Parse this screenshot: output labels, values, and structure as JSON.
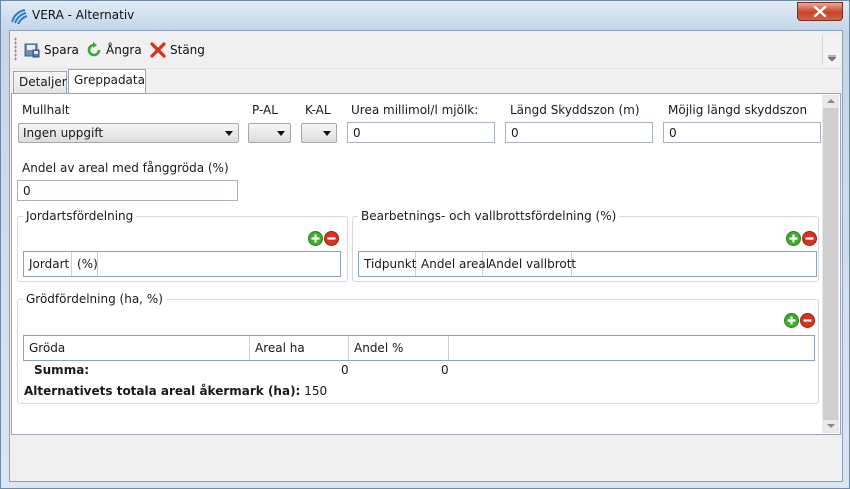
{
  "window": {
    "title": "VERA - Alternativ"
  },
  "toolbar": {
    "save_label": "Spara",
    "undo_label": "Ångra",
    "close_label": "Stäng"
  },
  "tabs": [
    {
      "label": "Detaljer"
    },
    {
      "label": "Greppadata"
    }
  ],
  "form": {
    "mullhalt": {
      "label": "Mullhalt",
      "value": "Ingen uppgift"
    },
    "pal": {
      "label": "P-AL",
      "value": ""
    },
    "kal": {
      "label": "K-AL",
      "value": ""
    },
    "urea": {
      "label": "Urea millimol/l mjölk:",
      "value": "0"
    },
    "skyddszon": {
      "label": "Längd Skyddszon (m)",
      "value": "0"
    },
    "mojlig": {
      "label": "Möjlig längd skyddszon",
      "value": "0"
    },
    "fanggroda": {
      "label": "Andel av areal med fånggröda (%)",
      "value": "0"
    }
  },
  "jordart_group": {
    "title": "Jordartsfördelning",
    "columns": [
      "Jordart",
      "(%)"
    ]
  },
  "bearbetning_group": {
    "title": "Bearbetnings- och vallbrottsfördelning (%)",
    "columns": [
      "Tidpunkt",
      "Andel areal",
      "Andel vallbrott"
    ]
  },
  "grod_group": {
    "title": "Grödfördelning (ha, %)",
    "columns": [
      "Gröda",
      "Areal ha",
      "Andel %"
    ],
    "summa_label": "Summa:",
    "summa_areal": "0",
    "summa_andel": "0"
  },
  "total": {
    "label": "Alternativets totala areal åkermark (ha):",
    "value": "150"
  }
}
